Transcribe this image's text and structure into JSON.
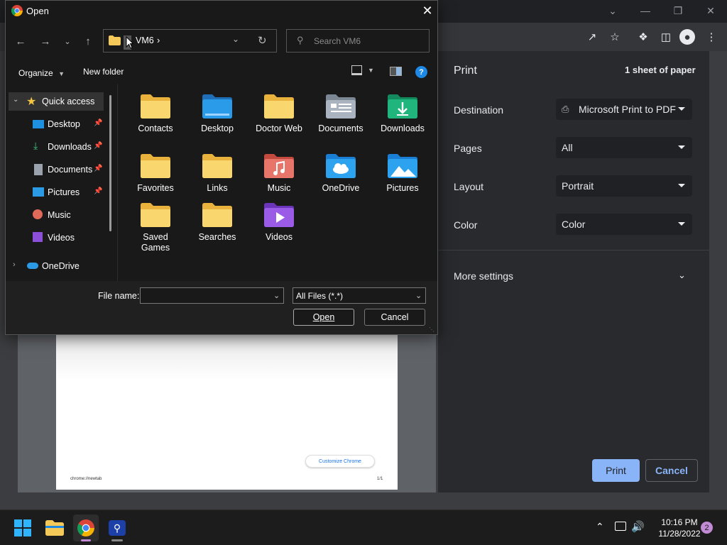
{
  "print_dialog": {
    "title": "Print",
    "sheets": "1 sheet of paper",
    "rows": [
      {
        "label": "Destination",
        "value": "Microsoft Print to PDF"
      },
      {
        "label": "Pages",
        "value": "All"
      },
      {
        "label": "Layout",
        "value": "Portrait"
      },
      {
        "label": "Color",
        "value": "Color"
      }
    ],
    "more_settings": "More settings",
    "print_button": "Print",
    "cancel_button": "Cancel"
  },
  "preview": {
    "footer_left": "chrome://newtab",
    "footer_right": "1/1",
    "customize_chrome": "Customize Chrome"
  },
  "open_dialog": {
    "title": "Open",
    "address_segment": "VM6",
    "search_placeholder": "Search VM6",
    "organize": "Organize",
    "new_folder": "New folder",
    "nav_items": [
      {
        "label": "Quick access",
        "icon": "star-icon"
      },
      {
        "label": "Desktop",
        "icon": "desktop-icon",
        "pinned": true
      },
      {
        "label": "Downloads",
        "icon": "download-icon",
        "pinned": true
      },
      {
        "label": "Documents",
        "icon": "documents-icon",
        "pinned": true
      },
      {
        "label": "Pictures",
        "icon": "pictures-icon",
        "pinned": true
      },
      {
        "label": "Music",
        "icon": "music-icon"
      },
      {
        "label": "Videos",
        "icon": "videos-icon"
      },
      {
        "label": "OneDrive",
        "icon": "onedrive-icon"
      }
    ],
    "folders": [
      {
        "label": "Contacts",
        "icon": "folder-icon"
      },
      {
        "label": "Desktop",
        "icon": "desktop-folder-icon"
      },
      {
        "label": "Doctor Web",
        "icon": "folder-icon"
      },
      {
        "label": "Documents",
        "icon": "documents-folder-icon"
      },
      {
        "label": "Downloads",
        "icon": "downloads-folder-icon"
      },
      {
        "label": "Favorites",
        "icon": "folder-icon"
      },
      {
        "label": "Links",
        "icon": "folder-icon"
      },
      {
        "label": "Music",
        "icon": "music-folder-icon"
      },
      {
        "label": "OneDrive",
        "icon": "onedrive-folder-icon"
      },
      {
        "label": "Pictures",
        "icon": "pictures-folder-icon"
      },
      {
        "label": "Saved Games",
        "icon": "folder-icon"
      },
      {
        "label": "Searches",
        "icon": "folder-icon"
      },
      {
        "label": "Videos",
        "icon": "videos-folder-icon"
      }
    ],
    "file_name_label": "File name:",
    "file_name_value": "",
    "file_type": "All Files (*.*)",
    "open_button": "Open",
    "cancel_button": "Cancel"
  },
  "taskbar": {
    "time": "10:16 PM",
    "date": "11/28/2022",
    "notification_count": "2"
  },
  "colors": {
    "accent_blue": "#8ab4f8",
    "folder_yellow": "#f5c85a",
    "dialog_bg": "#191919"
  }
}
